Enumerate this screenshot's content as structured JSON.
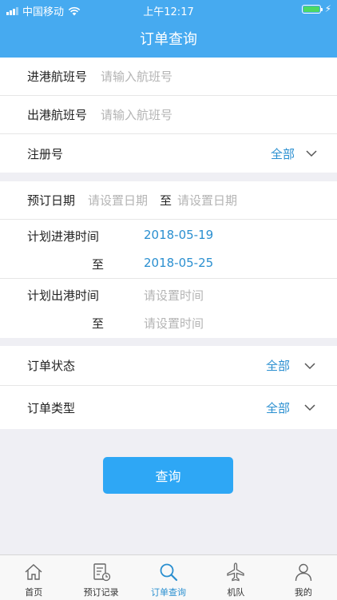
{
  "status": {
    "carrier": "中国移动",
    "time": "上午12:17"
  },
  "nav": {
    "title": "订单查询"
  },
  "form": {
    "inbound_flight": {
      "label": "进港航班号",
      "placeholder": "请输入航班号"
    },
    "outbound_flight": {
      "label": "出港航班号",
      "placeholder": "请输入航班号"
    },
    "registration": {
      "label": "注册号",
      "value": "全部"
    },
    "booking_date": {
      "label": "预订日期",
      "start_placeholder": "请设置日期",
      "separator": "至",
      "end_placeholder": "请设置日期"
    },
    "planned_arrival": {
      "label": "计划进港时间",
      "start": "2018-05-19",
      "separator": "至",
      "end": "2018-05-25"
    },
    "planned_departure": {
      "label": "计划出港时间",
      "start_placeholder": "请设置时间",
      "separator": "至",
      "end_placeholder": "请设置时间"
    },
    "order_status": {
      "label": "订单状态",
      "value": "全部"
    },
    "order_type": {
      "label": "订单类型",
      "value": "全部"
    }
  },
  "query_button": {
    "label": "查询"
  },
  "tabs": [
    {
      "label": "首页",
      "icon": "home-icon"
    },
    {
      "label": "预订记录",
      "icon": "records-icon"
    },
    {
      "label": "订单查询",
      "icon": "search-icon",
      "active": true
    },
    {
      "label": "机队",
      "icon": "plane-icon"
    },
    {
      "label": "我的",
      "icon": "user-icon"
    }
  ],
  "colors": {
    "primary": "#46aaf0",
    "accent": "#2a8fd0",
    "button": "#2ea7f5",
    "battery": "#4cd964"
  }
}
